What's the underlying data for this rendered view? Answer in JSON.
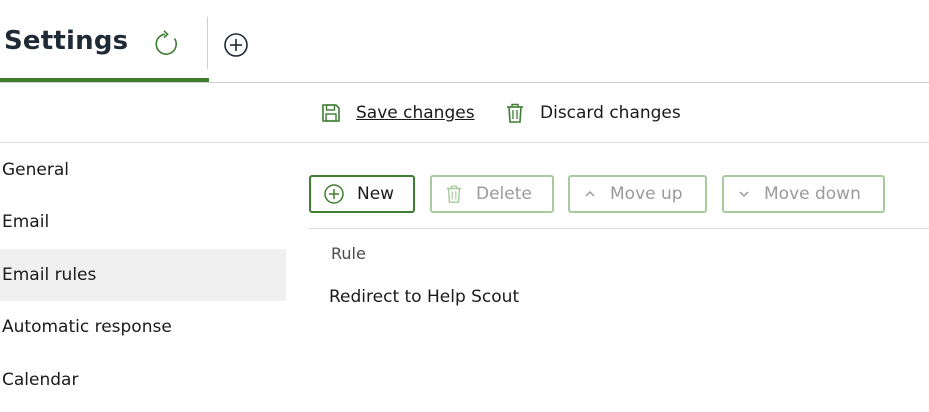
{
  "header": {
    "title": "Settings"
  },
  "toolbar": {
    "save_label": "Save changes",
    "discard_label": "Discard changes"
  },
  "nav": {
    "items": [
      {
        "label": "General"
      },
      {
        "label": "Email"
      },
      {
        "label": "Email rules",
        "selected": true
      },
      {
        "label": "Automatic response"
      },
      {
        "label": "Calendar"
      }
    ]
  },
  "rules_toolbar": {
    "new_label": "New",
    "delete_label": "Delete",
    "move_up_label": "Move up",
    "move_down_label": "Move down"
  },
  "rules_table": {
    "column_header": "Rule",
    "rows": [
      {
        "name": "Redirect to Help Scout"
      }
    ]
  },
  "colors": {
    "accent": "#3f7d33",
    "disabled_border": "#a8cb9e",
    "selected_bg": "#f0f0f0"
  },
  "icons": [
    "refresh-icon",
    "add-circle-icon",
    "save-icon",
    "trash-icon",
    "plus-circle-icon",
    "chevron-up-icon",
    "chevron-down-icon"
  ]
}
